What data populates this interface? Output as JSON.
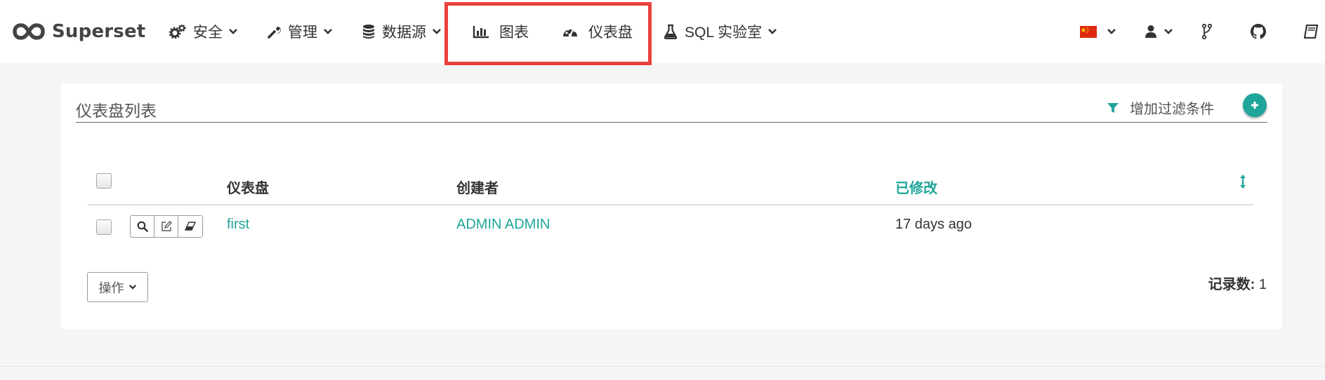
{
  "brand": {
    "name": "Superset"
  },
  "nav": {
    "items": [
      {
        "label": "安全",
        "icon": "gears-icon",
        "has_caret": true
      },
      {
        "label": "管理",
        "icon": "wrench-icon",
        "has_caret": true
      },
      {
        "label": "数据源",
        "icon": "database-icon",
        "has_caret": true
      },
      {
        "label": "图表",
        "icon": "bar-chart-icon",
        "has_caret": false
      },
      {
        "label": "仪表盘",
        "icon": "dashboard-icon",
        "has_caret": false
      },
      {
        "label": "SQL 实验室",
        "icon": "flask-icon",
        "has_caret": true
      }
    ],
    "right": [
      "china-flag-icon",
      "user-icon",
      "code-fork-icon",
      "github-icon",
      "book-icon"
    ]
  },
  "colors": {
    "accent": "#1fa59a",
    "highlight": "#e8403d"
  },
  "list": {
    "title": "仪表盘列表",
    "filter_label": "增加过滤条件",
    "columns": [
      "仪表盘",
      "创建者",
      "已修改"
    ],
    "sorted_column": "已修改",
    "rows": [
      {
        "dashboard": "first",
        "creator": "ADMIN ADMIN",
        "modified": "17 days ago"
      }
    ],
    "actions_label": "操作",
    "record_count_label": "记录数:",
    "record_count_value": "1"
  }
}
